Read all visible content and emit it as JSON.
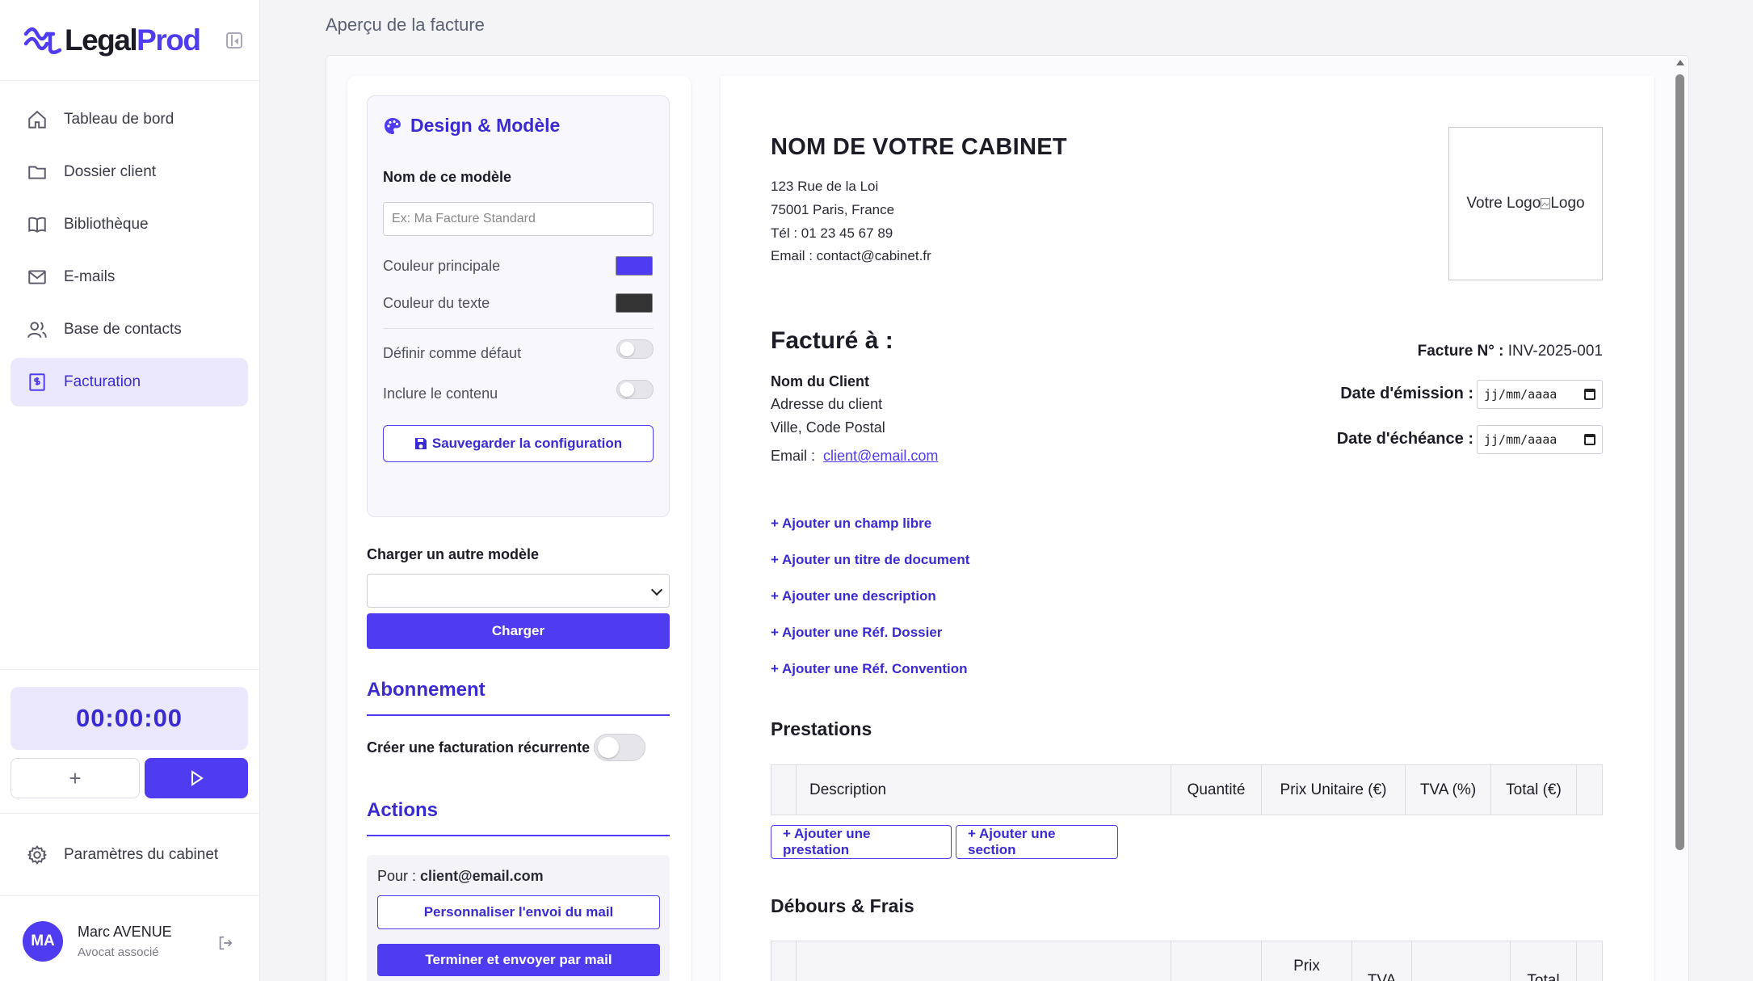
{
  "brand": {
    "name_part1": "Legal",
    "name_part2": "Prod",
    "accent": "#4f3cf0"
  },
  "sidebar": {
    "items": [
      {
        "label": "Tableau de bord",
        "icon": "home-icon",
        "active": false
      },
      {
        "label": "Dossier client",
        "icon": "folder-icon",
        "active": false
      },
      {
        "label": "Bibliothèque",
        "icon": "book-icon",
        "active": false
      },
      {
        "label": "E-mails",
        "icon": "mail-icon",
        "active": false
      },
      {
        "label": "Base de contacts",
        "icon": "users-icon",
        "active": false
      },
      {
        "label": "Facturation",
        "icon": "invoice-icon",
        "active": true
      }
    ],
    "timer": {
      "value": "00:00:00",
      "add_label": "+"
    },
    "settings_label": "Paramètres du cabinet",
    "user": {
      "initials": "MA",
      "name": "Marc AVENUE",
      "role": "Avocat associé"
    }
  },
  "main": {
    "title": "Aperçu de la facture"
  },
  "config": {
    "design_title": "Design & Modèle",
    "template_name_label": "Nom de ce modèle",
    "template_name_placeholder": "Ex: Ma Facture Standard",
    "primary_color_label": "Couleur principale",
    "primary_color": "#4f3cf0",
    "text_color_label": "Couleur du texte",
    "text_color": "#333333",
    "default_label": "Définir comme défaut",
    "include_content_label": "Inclure le contenu",
    "save_button": "Sauvegarder la configuration",
    "load_other_label": "Charger un autre modèle",
    "load_select_value": "",
    "load_button": "Charger",
    "subscription_title": "Abonnement",
    "recurring_label": "Créer une facturation récurrente",
    "actions_title": "Actions",
    "for_label": "Pour :",
    "for_email": "client@email.com",
    "customize_mail_button": "Personnaliser l'envoi du mail",
    "finish_send_button": "Terminer et envoyer par mail"
  },
  "invoice": {
    "firm_name": "NOM DE VOTRE CABINET",
    "address_line": "123 Rue de la Loi",
    "city_line": "75001 Paris, France",
    "phone_line": "Tél : 01 23 45 67 89",
    "email_line": "Email : contact@cabinet.fr",
    "logo_text": "Votre Logo",
    "logo_alt": "Logo",
    "billed_to_title": "Facturé à :",
    "client_name": "Nom du Client",
    "client_address": "Adresse du client",
    "client_city": "Ville, Code Postal",
    "client_email_label": "Email :",
    "client_email": "client@email.com",
    "invoice_no_label": "Facture N° :",
    "invoice_no": "INV-2025-001",
    "issue_date_label": "Date d'émission :",
    "due_date_label": "Date d'échéance :",
    "date_placeholder": "jj/mm/aaaa",
    "add_links": [
      "+ Ajouter un champ libre",
      "+ Ajouter un titre de document",
      "+ Ajouter une description",
      "+ Ajouter une Réf. Dossier",
      "+ Ajouter une Réf. Convention"
    ],
    "services_title": "Prestations",
    "services_columns": [
      "Description",
      "Quantité",
      "Prix Unitaire (€)",
      "TVA (%)",
      "Total (€)"
    ],
    "add_service_button": "+ Ajouter une prestation",
    "add_section_button": "+ Ajouter une section",
    "expenses_title": "Débours & Frais",
    "expenses_columns_visible": [
      "Prix",
      "TVA",
      "Total"
    ]
  }
}
